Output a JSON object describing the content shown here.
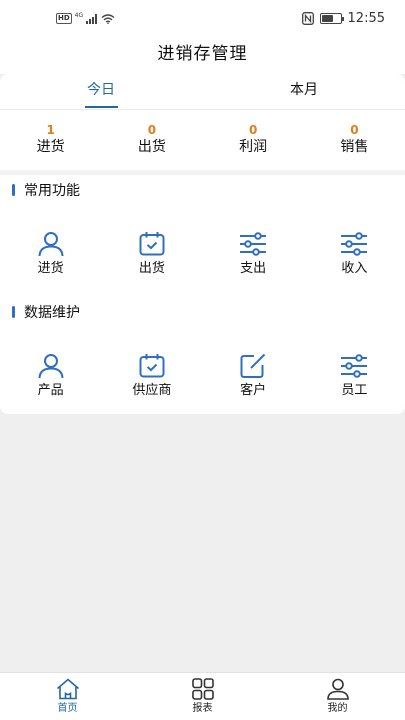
{
  "status_bar": {
    "network_label": "HD",
    "signal_gen": "4G",
    "time": "12:55",
    "battery_level": 0.7
  },
  "header": {
    "title": "进销存管理"
  },
  "tabs": [
    {
      "label": "今日",
      "active": true
    },
    {
      "label": "本月",
      "active": false
    }
  ],
  "stats": [
    {
      "value": "1",
      "label": "进货"
    },
    {
      "value": "0",
      "label": "出货"
    },
    {
      "value": "0",
      "label": "利润"
    },
    {
      "value": "0",
      "label": "销售"
    }
  ],
  "common_functions": {
    "title": "常用功能",
    "items": [
      {
        "label": "进货",
        "icon": "person-icon"
      },
      {
        "label": "出货",
        "icon": "calendar-check-icon"
      },
      {
        "label": "支出",
        "icon": "sliders-icon"
      },
      {
        "label": "收入",
        "icon": "sliders-icon"
      }
    ]
  },
  "data_maintenance": {
    "title": "数据维护",
    "items": [
      {
        "label": "产品",
        "icon": "person-icon"
      },
      {
        "label": "供应商",
        "icon": "calendar-check-icon"
      },
      {
        "label": "客户",
        "icon": "edit-icon"
      },
      {
        "label": "员工",
        "icon": "sliders-icon"
      }
    ]
  },
  "bottom_nav": [
    {
      "label": "首页",
      "icon": "home-icon",
      "active": true
    },
    {
      "label": "报表",
      "icon": "grid-icon",
      "active": false
    },
    {
      "label": "我的",
      "icon": "user-icon",
      "active": false
    }
  ],
  "colors": {
    "accent": "#2266aa",
    "icon_blue": "#2e6fc1",
    "stat_orange": "#e07f1b"
  }
}
